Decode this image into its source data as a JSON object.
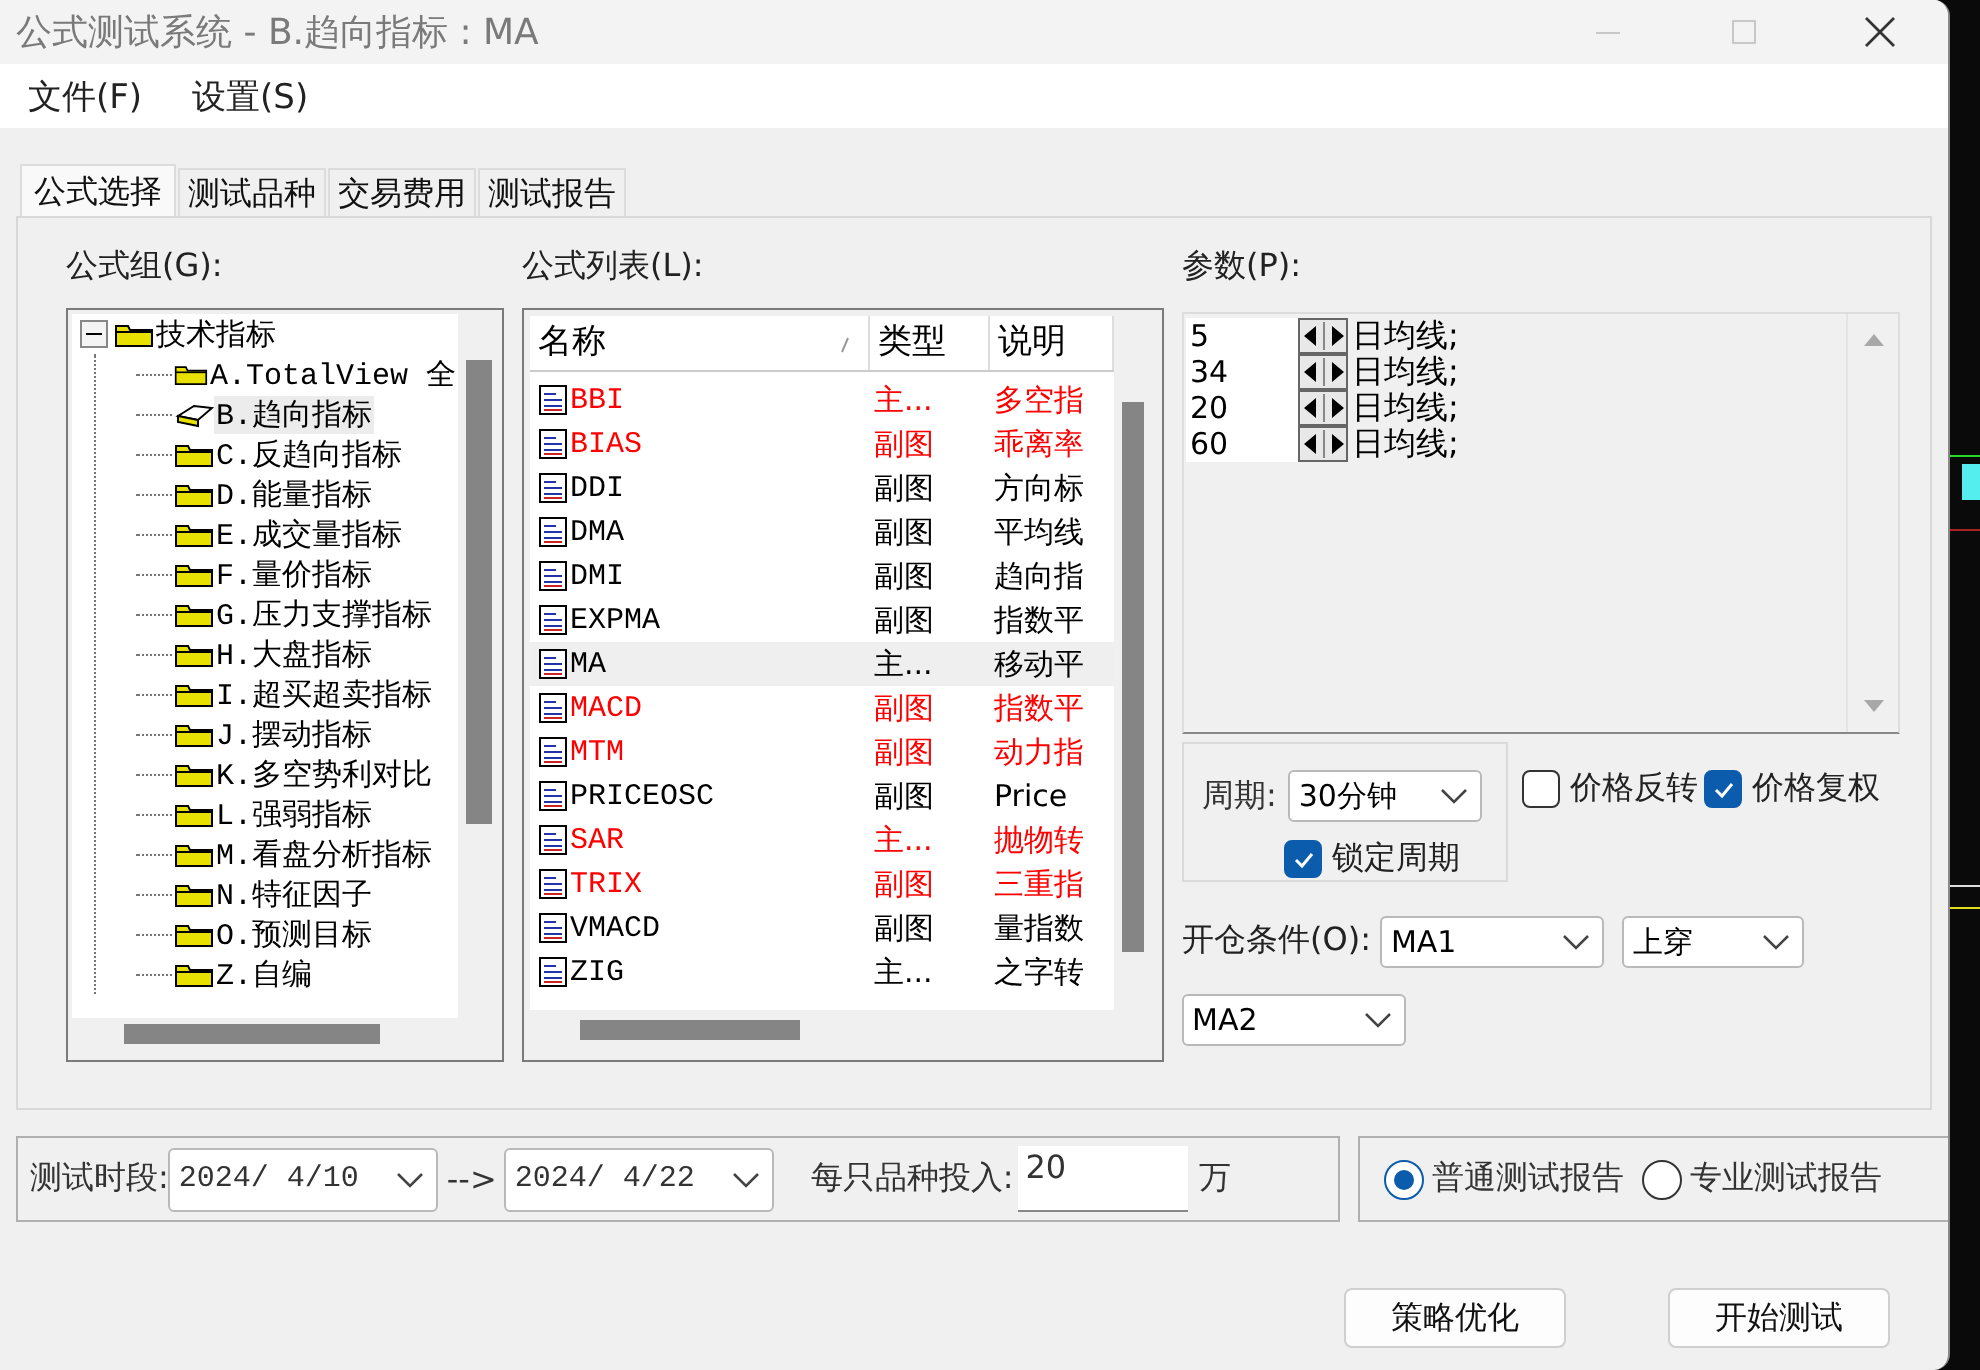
{
  "window": {
    "title": "公式测试系统 - B.趋向指标 : MA"
  },
  "menu": [
    {
      "label": "文件(F)"
    },
    {
      "label": "设置(S)"
    }
  ],
  "tabs": [
    {
      "label": "公式选择",
      "selected": true
    },
    {
      "label": "测试品种",
      "selected": false
    },
    {
      "label": "交易费用",
      "selected": false
    },
    {
      "label": "测试报告",
      "selected": false
    }
  ],
  "formula_group": {
    "label": "公式组(G):",
    "tree": [
      {
        "label": "技术指标",
        "expanded": true,
        "children": [
          {
            "label": "A.TotalView 全",
            "selected": false
          },
          {
            "label": "B.趋向指标",
            "selected": true
          },
          {
            "label": "C.反趋向指标",
            "selected": false
          },
          {
            "label": "D.能量指标",
            "selected": false
          },
          {
            "label": "E.成交量指标",
            "selected": false
          },
          {
            "label": "F.量价指标",
            "selected": false
          },
          {
            "label": "G.压力支撑指标",
            "selected": false
          },
          {
            "label": "H.大盘指标",
            "selected": false
          },
          {
            "label": "I.超买超卖指标",
            "selected": false
          },
          {
            "label": "J.摆动指标",
            "selected": false
          },
          {
            "label": "K.多空势利对比",
            "selected": false
          },
          {
            "label": "L.强弱指标",
            "selected": false
          },
          {
            "label": "M.看盘分析指标",
            "selected": false
          },
          {
            "label": "N.特征因子",
            "selected": false
          },
          {
            "label": "O.预测目标",
            "selected": false
          },
          {
            "label": "Z.自编",
            "selected": false
          }
        ]
      }
    ]
  },
  "formula_list": {
    "label": "公式列表(L):",
    "columns": [
      "名称",
      "类型",
      "说明"
    ],
    "rows": [
      {
        "name": "BBI",
        "type": "主...",
        "description": "多空指",
        "color": "#ff0000",
        "selected": false
      },
      {
        "name": "BIAS",
        "type": "副图",
        "description": "乖离率",
        "color": "#ff0000",
        "selected": false
      },
      {
        "name": "DDI",
        "type": "副图",
        "description": "方向标",
        "color": "#000000",
        "selected": false
      },
      {
        "name": "DMA",
        "type": "副图",
        "description": "平均线",
        "color": "#000000",
        "selected": false
      },
      {
        "name": "DMI",
        "type": "副图",
        "description": "趋向指",
        "color": "#000000",
        "selected": false
      },
      {
        "name": "EXPMA",
        "type": "副图",
        "description": "指数平",
        "color": "#000000",
        "selected": false
      },
      {
        "name": "MA",
        "type": "主...",
        "description": "移动平",
        "color": "#000000",
        "selected": true
      },
      {
        "name": "MACD",
        "type": "副图",
        "description": "指数平",
        "color": "#ff0000",
        "selected": false
      },
      {
        "name": "MTM",
        "type": "副图",
        "description": "动力指",
        "color": "#ff0000",
        "selected": false
      },
      {
        "name": "PRICEOSC",
        "type": "副图",
        "description": "Price",
        "color": "#000000",
        "selected": false
      },
      {
        "name": "SAR",
        "type": "主...",
        "description": "抛物转",
        "color": "#ff0000",
        "selected": false
      },
      {
        "name": "TRIX",
        "type": "副图",
        "description": "三重指",
        "color": "#ff0000",
        "selected": false
      },
      {
        "name": "VMACD",
        "type": "副图",
        "description": "量指数",
        "color": "#000000",
        "selected": false
      },
      {
        "name": "ZIG",
        "type": "主...",
        "description": "之字转",
        "color": "#000000",
        "selected": false
      }
    ]
  },
  "parameters": {
    "label": "参数(P):",
    "rows": [
      {
        "value": "5",
        "unit": "日均线;"
      },
      {
        "value": "34",
        "unit": "日均线;"
      },
      {
        "value": "20",
        "unit": "日均线;"
      },
      {
        "value": "60",
        "unit": "日均线;"
      }
    ]
  },
  "period": {
    "label": "周期:",
    "value": "30分钟",
    "lock": {
      "label": "锁定周期",
      "checked": true
    }
  },
  "options": [
    {
      "label": "价格反转",
      "checked": false
    },
    {
      "label": "价格复权",
      "checked": true
    }
  ],
  "open_condition": {
    "label": "开仓条件(O):",
    "left": "MA1",
    "operator": "上穿",
    "right": "MA2"
  },
  "test_period": {
    "label": "测试时段:",
    "start": "2024/ 4/10",
    "arrow": "-->",
    "end": "2024/ 4/22"
  },
  "investment": {
    "label": "每只品种投入:",
    "value": "20",
    "unit": "万"
  },
  "report_type": [
    {
      "label": "普通测试报告",
      "selected": true
    },
    {
      "label": "专业测试报告",
      "selected": false
    }
  ],
  "buttons": [
    "策略优化",
    "开始测试"
  ]
}
